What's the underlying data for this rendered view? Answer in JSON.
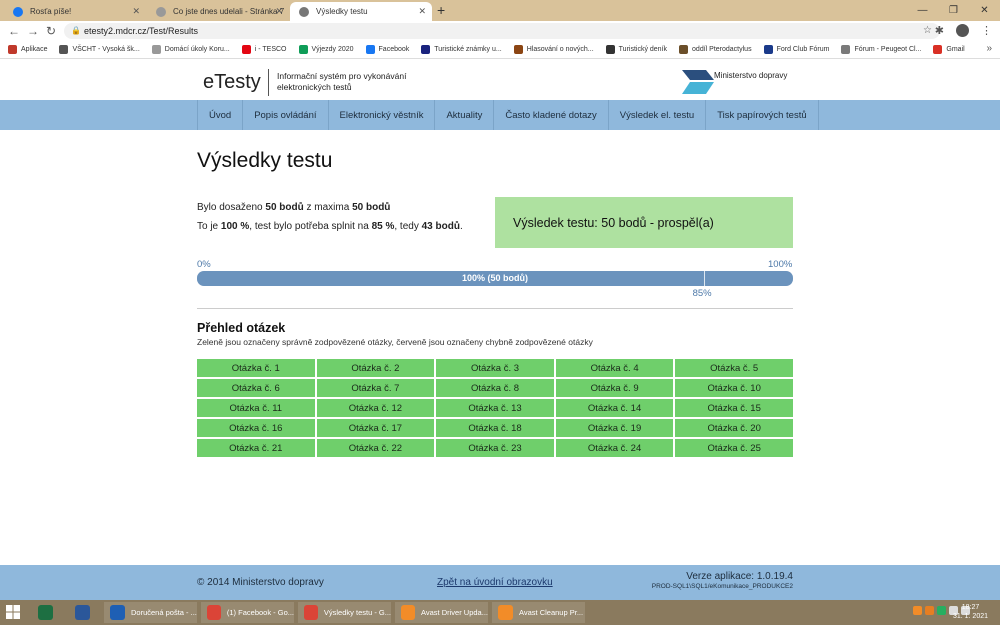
{
  "browser": {
    "tabs": [
      {
        "title": "Rosťa píše!",
        "icon_color": "#1877f2"
      },
      {
        "title": "Co jste dnes udelali - Stránka 7",
        "icon_color": "#888888"
      },
      {
        "title": "Výsledky testu",
        "icon_color": "#666666"
      }
    ],
    "new_tab_symbol": "+",
    "url": "etesty2.mdcr.cz/Test/Results",
    "bookmarks": [
      {
        "label": "Aplikace",
        "color": "#c0392b"
      },
      {
        "label": "VŠCHT - Vysoká šk...",
        "color": "#555555"
      },
      {
        "label": "Domácí úkoly Koru...",
        "color": "#999999"
      },
      {
        "label": "i - TESCO",
        "color": "#e30613"
      },
      {
        "label": "Výjezdy 2020",
        "color": "#0f9d58"
      },
      {
        "label": "Facebook",
        "color": "#1877f2"
      },
      {
        "label": "Turistické známky u...",
        "color": "#1a237e"
      },
      {
        "label": "Hlasování o nových...",
        "color": "#8b4513"
      },
      {
        "label": "Turistický deník",
        "color": "#333333"
      },
      {
        "label": "oddíl Pterodactylus",
        "color": "#6b4f2a"
      },
      {
        "label": "Ford Club Fórum",
        "color": "#1a3a8a"
      },
      {
        "label": "Fórum - Peugeot Cl...",
        "color": "#7a7a7a"
      },
      {
        "label": "Gmail",
        "color": "#d93025"
      }
    ]
  },
  "site": {
    "logo": "eTesty",
    "logo_subtitle": "Informační systém pro vykonávání elektronických testů",
    "ministry": "Ministerstvo dopravy",
    "nav": [
      "Úvod",
      "Popis ovládání",
      "Elektronický věstník",
      "Aktuality",
      "Často kladené dotazy",
      "Výsledek el. testu",
      "Tisk papírových testů"
    ]
  },
  "results": {
    "title": "Výsledky testu",
    "line1": {
      "prefix": "Bylo dosaženo ",
      "points": "50 bodů",
      "mid": " z maxima ",
      "max": "50 bodů"
    },
    "line2": {
      "prefix": "To je ",
      "percent": "100 %",
      "mid": ", test bylo potřeba splnit na ",
      "required_percent": "85 %",
      "mid2": ", tedy ",
      "required_points": "43 bodů",
      "suffix": "."
    },
    "verdict": "Výsledek testu: 50 bodů - prospěl(a)",
    "progress": {
      "min_label": "0%",
      "max_label": "100%",
      "fill_percent": 100,
      "bar_label": "100% (50 bodů)",
      "threshold_percent": 85,
      "threshold_label": "85%"
    }
  },
  "overview": {
    "title": "Přehled otázek",
    "note": "Zeleně jsou označeny správně zodpovězené otázky, červeně jsou označeny chybně zodpovězené otázky",
    "questions": [
      "Otázka č. 1",
      "Otázka č. 2",
      "Otázka č. 3",
      "Otázka č. 4",
      "Otázka č. 5",
      "Otázka č. 6",
      "Otázka č. 7",
      "Otázka č. 8",
      "Otázka č. 9",
      "Otázka č. 10",
      "Otázka č. 11",
      "Otázka č. 12",
      "Otázka č. 13",
      "Otázka č. 14",
      "Otázka č. 15",
      "Otázka č. 16",
      "Otázka č. 17",
      "Otázka č. 18",
      "Otázka č. 19",
      "Otázka č. 20",
      "Otázka č. 21",
      "Otázka č. 22",
      "Otázka č. 23",
      "Otázka č. 24",
      "Otázka č. 25"
    ],
    "correct_color": "#6fcf6b"
  },
  "footer": {
    "copyright": "© 2014 Ministerstvo dopravy",
    "back_link": "Zpět na úvodní obrazovku",
    "version": "Verze aplikace: 1.0.19.4",
    "server": "PROD-SQL1\\SQL1/eKomunikace_PRODUKCE2"
  },
  "taskbar": {
    "apps": [
      {
        "label": "Doručená pošta - ...",
        "color": "#1e5fb4"
      },
      {
        "label": "(1) Facebook - Go...",
        "color": "#db4437"
      },
      {
        "label": "Výsledky testu - G...",
        "color": "#db4437"
      },
      {
        "label": "Avast Driver Upda...",
        "color": "#f28c28"
      },
      {
        "label": "Avast Cleanup Pr...",
        "color": "#f28c28"
      }
    ],
    "time": "18:27",
    "date": "31. 1. 2021"
  }
}
